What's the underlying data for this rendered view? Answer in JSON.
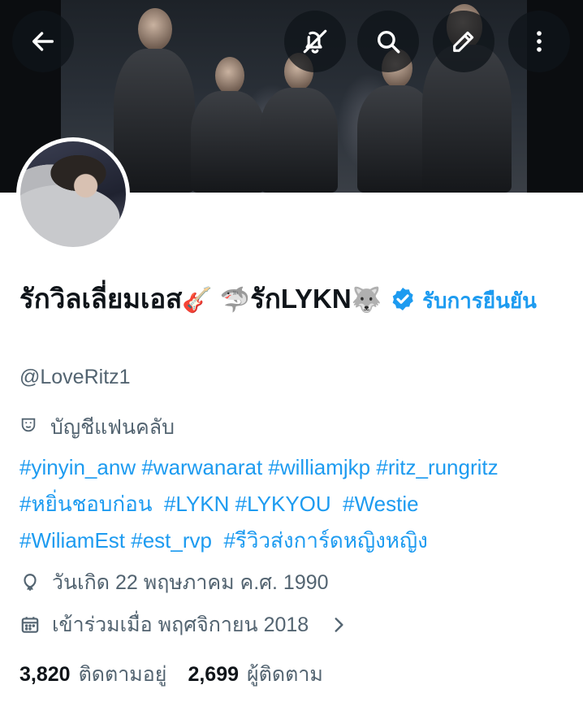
{
  "header": {
    "back_icon": "arrow-left-icon",
    "notifications_icon": "bell-off-icon",
    "search_icon": "search-icon",
    "edit_icon": "pencil-icon",
    "more_icon": "more-vertical-icon"
  },
  "profile": {
    "display_name": "รักวิลเลี่ยมเอส",
    "emoji_guitar": "🎸",
    "emoji_shark": "🦈",
    "display_name_2": "รักLYKN",
    "emoji_wolf": "🐺",
    "subscribe_label": "รับการยืนยัน",
    "handle": "@LoveRitz1",
    "category": "บัญชีแฟนคลับ",
    "verified_color": "#1d9bf0"
  },
  "bio": {
    "lines": [
      [
        "#yinyin_anw",
        "#warwanarat",
        "#williamjkp",
        "#ritz_rungritz"
      ],
      [
        "#หยิ่นชอบก่อน",
        "#LYKN",
        "#LYKYOU",
        "#Westie"
      ],
      [
        "#WiliamEst",
        "#est_rvp",
        "#รีวิวส่งการ์ดหญิงหญิง"
      ]
    ]
  },
  "meta": {
    "birthday": "วันเกิด 22 พฤษภาคม ค.ศ. 1990",
    "joined": "เข้าร่วมเมื่อ พฤศจิกายน 2018"
  },
  "stats": {
    "following_count": "3,820",
    "following_label": "ติดตามอยู่",
    "followers_count": "2,699",
    "followers_label": "ผู้ติดตาม"
  },
  "colors": {
    "link": "#1d9bf0",
    "secondary_text": "#536471",
    "primary_text": "#0f1419"
  }
}
